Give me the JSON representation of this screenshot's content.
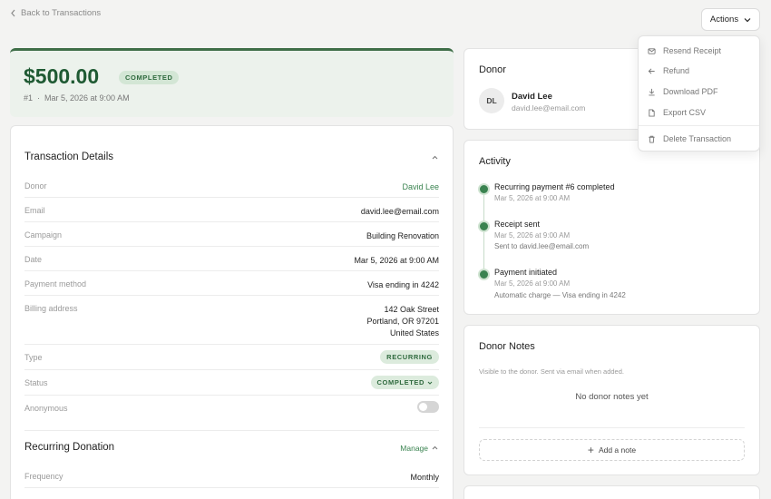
{
  "nav": {
    "back_label": "Back to Transactions"
  },
  "header": {
    "actions_label": "Actions"
  },
  "hero": {
    "amount": "$500.00",
    "status": "COMPLETED",
    "number": "#1",
    "date": "Mar 5, 2026 at 9:00 AM"
  },
  "details": {
    "title": "Transaction Details",
    "rows": {
      "donor": {
        "label": "Donor",
        "value": "David Lee"
      },
      "email": {
        "label": "Email",
        "value": "david.lee@email.com"
      },
      "campaign": {
        "label": "Campaign",
        "value": "Building Renovation"
      },
      "date": {
        "label": "Date",
        "value": "Mar 5, 2026 at 9:00 AM"
      },
      "payment": {
        "label": "Payment method",
        "value": "Visa ending in 4242"
      },
      "billing": {
        "label": "Billing address",
        "line1": "142 Oak Street",
        "line2": "Portland, OR 97201",
        "line3": "United States"
      },
      "type": {
        "label": "Type",
        "value": "RECURRING"
      },
      "status": {
        "label": "Status",
        "value": "COMPLETED"
      },
      "anonymous": {
        "label": "Anonymous",
        "checked": false
      }
    }
  },
  "recurring": {
    "title": "Recurring Donation",
    "manage_label": "Manage",
    "frequency": {
      "label": "Frequency",
      "value": "Monthly"
    }
  },
  "donor_card": {
    "title": "Donor",
    "initials": "DL",
    "name": "David Lee",
    "email": "david.lee@email.com"
  },
  "activity": {
    "title": "Activity",
    "items": [
      {
        "title": "Recurring payment #6 completed",
        "time": "Mar 5, 2026 at 9:00 AM",
        "desc": ""
      },
      {
        "title": "Receipt sent",
        "time": "Mar 5, 2026 at 9:00 AM",
        "desc": "Sent to david.lee@email.com"
      },
      {
        "title": "Payment initiated",
        "time": "Mar 5, 2026 at 9:00 AM",
        "desc": "Automatic charge — Visa ending in 4242"
      }
    ]
  },
  "notes": {
    "title": "Donor Notes",
    "subtitle": "Visible to the donor. Sent via email when added.",
    "empty": "No donor notes yet",
    "add_label": "Add a note"
  },
  "menu": {
    "items": [
      {
        "label": "Resend Receipt",
        "icon": "mail-icon"
      },
      {
        "label": "Refund",
        "icon": "arrow-left-icon"
      },
      {
        "label": "Download PDF",
        "icon": "download-icon"
      },
      {
        "label": "Export CSV",
        "icon": "file-icon"
      },
      {
        "label": "Delete Transaction",
        "icon": "trash-icon"
      }
    ]
  },
  "colors": {
    "accent": "#3a8350",
    "hero_bg": "#ecf2ec",
    "amount": "#1f5a33"
  }
}
